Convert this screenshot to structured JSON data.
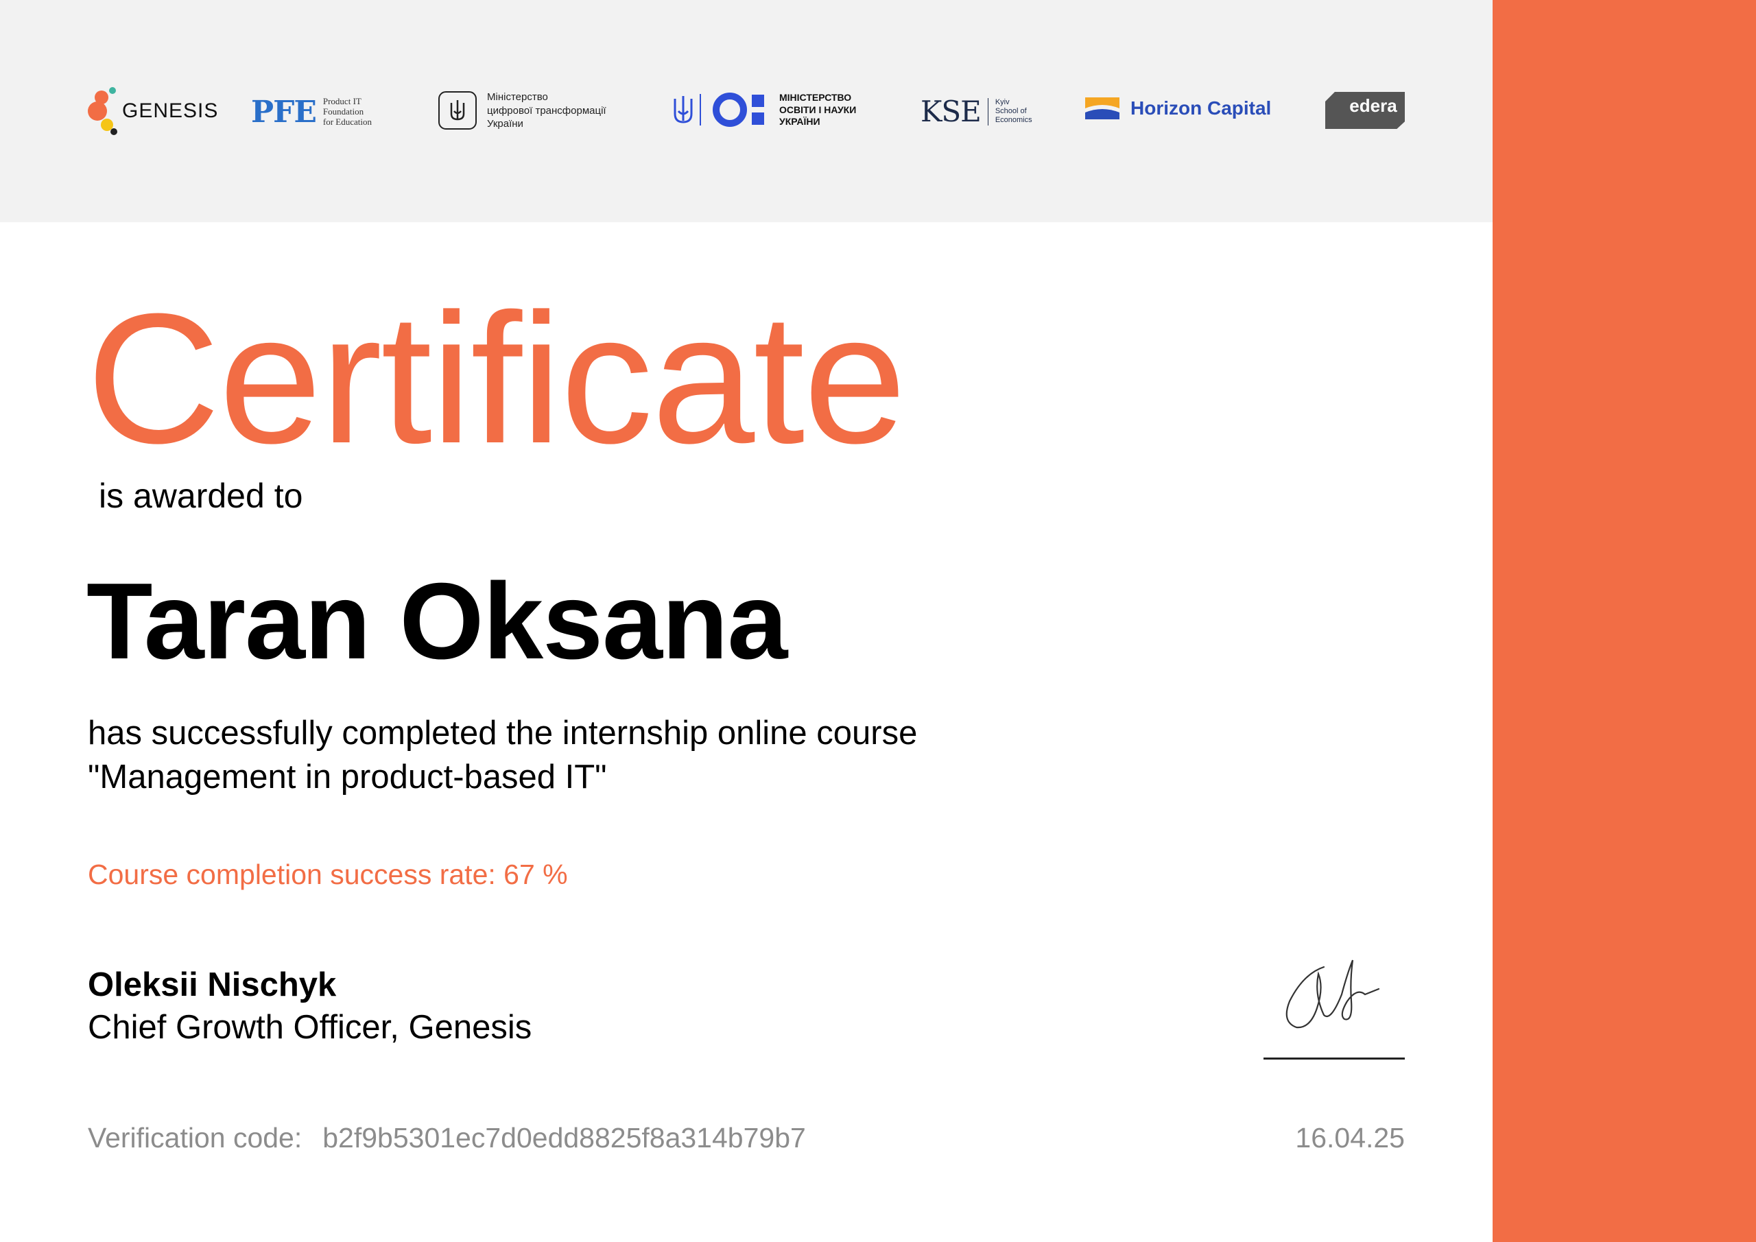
{
  "colors": {
    "accent": "#f26d45",
    "header_band": "#f2f2f2",
    "muted_text": "#8c8c8c"
  },
  "logos": {
    "genesis": {
      "text": "GENESIS",
      "icon": "genesis-dots-icon"
    },
    "pfe": {
      "mark": "PFE",
      "line1": "Product IT",
      "line2": "Foundation",
      "line3": "for Education"
    },
    "ministry_digital": {
      "line1": "Міністерство",
      "line2": "цифрової трансформації",
      "line3": "України",
      "icon": "trident-icon"
    },
    "ministry_education": {
      "line1": "МІНІСТЕРСТВО",
      "line2": "ОСВІТИ І НАУКИ",
      "line3": "УКРАЇНИ",
      "icon": "trident-icon"
    },
    "kse": {
      "mark": "KSE",
      "line1": "Kyiv",
      "line2": "School of",
      "line3": "Economics"
    },
    "horizon": {
      "text": "Horizon Capital",
      "icon": "horizon-sun-icon"
    },
    "edera": {
      "text": "edera"
    }
  },
  "certificate": {
    "title": "Certificate",
    "awarded_text": "is awarded to",
    "recipient": "Taran Oksana",
    "completion_line1": "has successfully completed the internship online course",
    "completion_line2": "\"Management in product-based IT\"",
    "success_rate_text": "Course completion success rate: 67 %",
    "signer_name": "Oleksii Nischyk",
    "signer_role": "Chief Growth Officer, Genesis",
    "verification_label": "Verification code:",
    "verification_code": "b2f9b5301ec7d0edd8825f8a314b79b7",
    "date": "16.04.25"
  }
}
